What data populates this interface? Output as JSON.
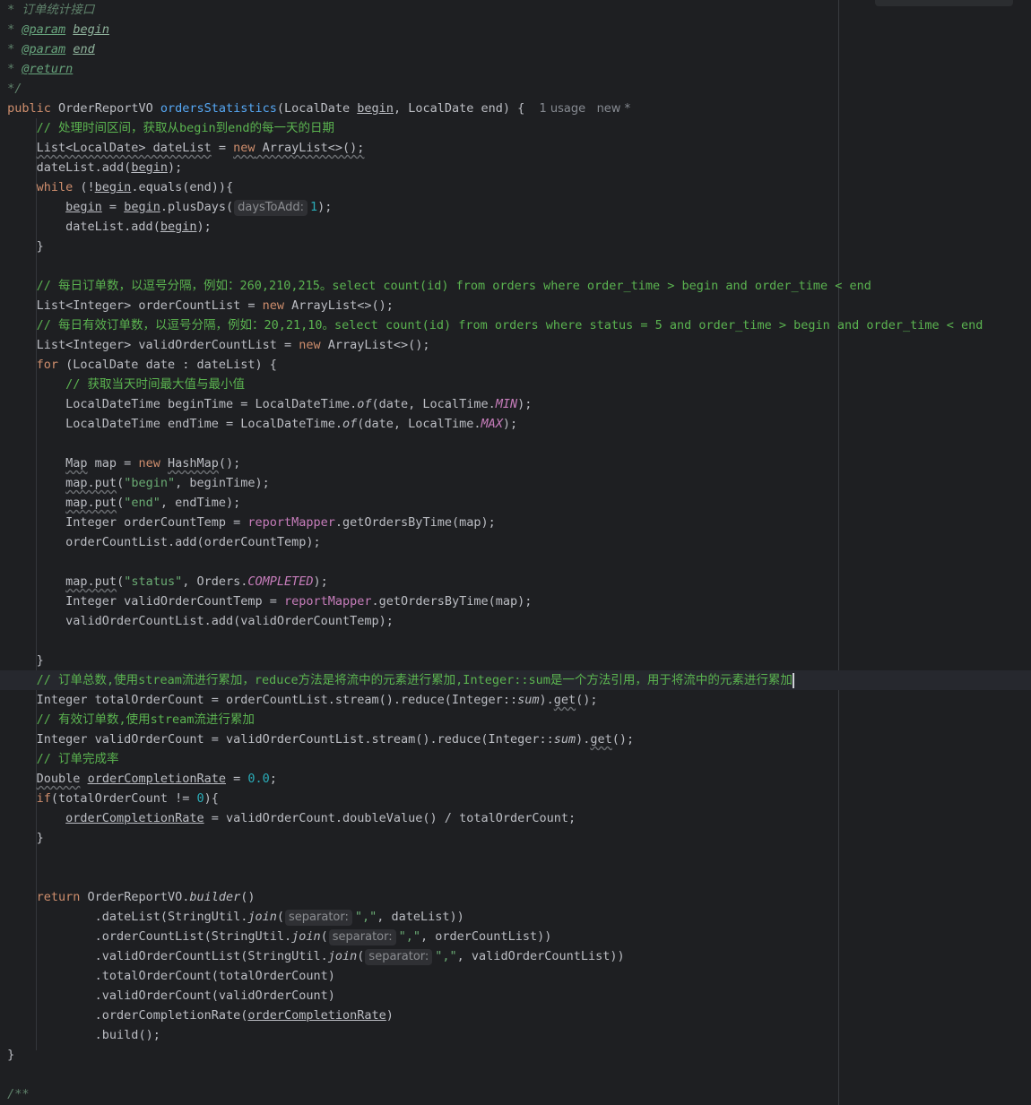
{
  "theme": {
    "background": "#1e1f22",
    "current_line": "#26282e",
    "keyword": "#cf8e6d",
    "function": "#56a8f5",
    "comment": "#5bb450",
    "string": "#6aab73",
    "number": "#2aacb8",
    "constant": "#c77dbb"
  },
  "code": {
    "doc": {
      "title": " * 订单统计接口",
      "param": "@param",
      "begin": "begin",
      "end": "end",
      "return": "@return",
      "close": " */",
      "star": " * "
    },
    "signature": {
      "public": "public",
      "type": " OrderReportVO ",
      "name": "ordersStatistics",
      "p1": "(LocalDate ",
      "p1name": "begin",
      "p2": ", LocalDate end) {",
      "usage": "1 usage",
      "new": "new *"
    },
    "c_range": "// 处理时间区间，获取从begin到end的每一天的日期",
    "datelist_decl_a": "List<LocalDate> dateList",
    "datelist_decl_b": " = ",
    "new": "new",
    "arraylist_new": " ArrayList<>();",
    "datelist_add": "dateList.add(",
    "begin": "begin",
    "close_paren_semi": ");",
    "while": "while",
    "while_a": " (!",
    "while_b": ".equals(end)){",
    "assign": " = ",
    "plus_days": ".plusDays(",
    "hint_days": "daysToAdd:",
    "one": "1",
    "rbrace": "}",
    "c_daily": "// 每日订单数，以逗号分隔，例如：260,210,215。select count(id) from orders where order_time > begin and order_time < end",
    "order_count_list": "List<Integer> orderCountList = ",
    "c_valid_daily": "// 每日有效订单数，以逗号分隔，例如：20,21,10。select count(id) from orders where status = 5 and order_time > begin and order_time < end",
    "valid_count_list": "List<Integer> validOrderCountList = ",
    "for": "for",
    "for_rest": " (LocalDate date : dateList) {",
    "c_minmax": "// 获取当天时间最大值与最小值",
    "begin_time_a": "LocalDateTime beginTime = LocalDateTime.",
    "of": "of",
    "date_localtime": "(date, LocalTime.",
    "min": "MIN",
    "end_time_a": "LocalDateTime endTime = LocalDateTime.",
    "max": "MAX",
    "map_type": "Map",
    "map_decl": " map = ",
    "hashmap": "HashMap",
    "parens_semi": "();",
    "map_put": "map.put",
    "str_begin": "\"begin\"",
    "begin_time_arg": ", beginTime);",
    "str_end": "\"end\"",
    "end_time_arg": ", endTime);",
    "oct_decl": "Integer orderCountTemp = ",
    "report_mapper": "reportMapper",
    "get_orders": ".getOrdersByTime(map);",
    "oct_add": "orderCountList.add(orderCountTemp);",
    "str_status": "\"status\"",
    "orders_dot": ", Orders.",
    "completed": "COMPLETED",
    "voct_decl": "Integer validOrderCountTemp = ",
    "voct_add": "validOrderCountList.add(validOrderCountTemp);",
    "c_total": "// 订单总数,使用stream流进行累加，reduce方法是将流中的元素进行累加,Integer::sum是一个方法引用，用于将流中的元素进行累加",
    "total_decl": "Integer totalOrderCount = orderCountList.stream().reduce(Integer::",
    "sum": "sum",
    "close_dot": ").",
    "get": "get",
    "c_valid_total": "// 有效订单数,使用stream流进行累加",
    "valid_decl": "Integer validOrderCount = validOrderCountList.stream().reduce(Integer::",
    "c_rate": "// 订单完成率",
    "double": "Double",
    "rate_var": "orderCompletionRate",
    "zero_point": "0.0",
    "semi": ";",
    "if": "if",
    "if_rest": "(totalOrderCount != ",
    "zero": "0",
    "if_close": "){",
    "rate_expr": " = validOrderCount.doubleValue() / totalOrderCount;",
    "return": "return",
    "builder_a": " OrderReportVO.",
    "builder": "builder",
    "parens": "()",
    "dl_a": ".dateList(StringUtil.",
    "join": "join",
    "open": "(",
    "hint_sep": "separator:",
    "comma_str": "\",\"",
    "dl_b": ", dateList))",
    "ocl_a": ".orderCountList(StringUtil.",
    "ocl_b": ", orderCountList))",
    "vocl_a": ".validOrderCountList(StringUtil.",
    "vocl_b": ", validOrderCountList))",
    "toc": ".totalOrderCount(totalOrderCount)",
    "voc": ".validOrderCount(validOrderCount)",
    "ocr_a": ".orderCompletionRate(",
    "close_paren": ")",
    "build": ".build();",
    "doc_open": "/**"
  }
}
